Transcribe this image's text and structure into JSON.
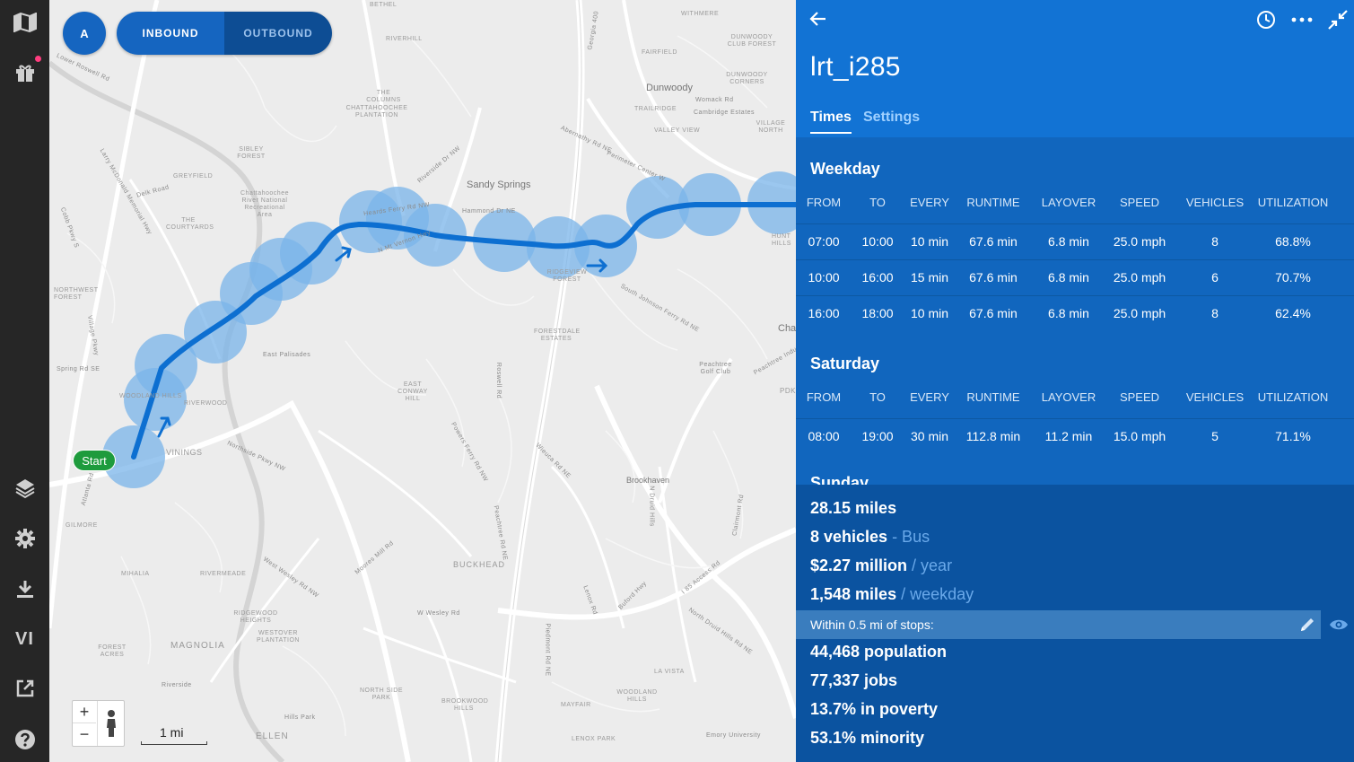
{
  "sidebar": {
    "items": [
      {
        "name": "map",
        "icon": "map-icon"
      },
      {
        "name": "gift",
        "icon": "gift-icon"
      },
      {
        "name": "layers",
        "icon": "layers-icon"
      },
      {
        "name": "settings",
        "icon": "gear-icon"
      },
      {
        "name": "download",
        "icon": "download-icon"
      },
      {
        "name": "vi",
        "label": "VI"
      },
      {
        "name": "export",
        "icon": "export-icon"
      },
      {
        "name": "help",
        "icon": "help-icon"
      }
    ]
  },
  "map": {
    "route_letter": "A",
    "inbound_label": "INBOUND",
    "outbound_label": "OUTBOUND",
    "start_label": "Start",
    "zoom_in": "+",
    "zoom_out": "−",
    "scale": "1 mi",
    "labels": {
      "dunwoody": "Dunwoody",
      "sandy_springs": "Sandy Springs",
      "buckhead": "BUCKHEAD",
      "brookhaven": "Brookhaven",
      "vinings": "VININGS",
      "magnolia": "MAGNOLIA",
      "ellen": "ELLEN",
      "cha": "Cha",
      "pdk": "PDK",
      "riverhill": "RIVERHILL",
      "bethel": "BETHEL",
      "the_columns": "THE COLUMNS",
      "chattahoochee_plantation": "CHATTAHOOCHEE PLANTATION",
      "sibley_forest": "SIBLEY FOREST",
      "greyfield": "GREYFIELD",
      "the_courtyards": "THE COURTYARDS",
      "northwest_forest": "NORTHWEST FOREST",
      "woodland_hills": "WOODLAND HILLS",
      "forestdale_estates": "FORESTDALE ESTATES",
      "east_conway_hill": "EAST CONWAY HILL",
      "riverwood": "RIVERWOOD",
      "gilmore": "GILMORE",
      "mihalia": "MIHALIA",
      "rivermeade": "RIVERMEADE",
      "ridgewood_heights": "RIDGEWOOD HEIGHTS",
      "westover_plantation": "WESTOVER PLANTATION",
      "forest_acres": "FOREST ACRES",
      "north_side_park": "NORTH SIDE PARK",
      "brookwood_hills": "BROOKWOOD HILLS",
      "woodland_hills2": "WOODLAND HILLS",
      "mayfair": "MAYFAIR",
      "lenox_park": "LENOX PARK",
      "la_vista": "LA VISTA",
      "fairfield": "FAIRFIELD",
      "trailridge": "TRAILRIDGE",
      "valley_view": "VALLEY VIEW",
      "dunwoody_corners": "DUNWOODY CORNERS",
      "village_north": "VILLAGE NORTH",
      "withmere": "WITHMERE",
      "dunwoody_club_forest": "DUNWOODY CLUB FOREST",
      "chattahoochee_rec": "Chattahoochee River National Recreational Area",
      "east_palisades": "East Palisades",
      "peachtree_golf": "Peachtree Golf Club",
      "hills_park": "Hills Park",
      "emory_university": "Emory University",
      "hunt_hills": "HUNT HILLS",
      "roswell_rd": "Roswell Rd",
      "northside_pkwy": "Northside Pkwy NW",
      "w_wesley": "W Wesley Rd",
      "west_wesley": "West Wesley Rd NW",
      "moores_mill": "Moores Mill Rd",
      "powers_ferry": "Powers Ferry Rd NW",
      "wieuca": "Wieuca Rd NE",
      "n_druid_hills": "N Druid Hills",
      "peachtree_rd": "Peachtree Rd NE",
      "piedmont_rd": "Piedmont Rd NE",
      "lenox_rd": "Lenox Rd",
      "buford_hwy": "Buford Hwy",
      "i85_access": "I 85 Access Rd",
      "north_druid_hills_rd": "North Druid Hills Rd NE",
      "clairmont": "Clairmont Rd",
      "riverside": "Riverside",
      "heards_ferry": "Heards Ferry Rd NW",
      "hammond": "Hammond Dr NE",
      "mt_vernon": "N Mt Vernon Hwy",
      "ridgeview": "RIDGEVIEW FOREST",
      "south_johnson": "South Johnson Ferry Rd NE",
      "abernathy": "Abernathy Rd NE",
      "perimeter": "Perimeter Center W",
      "peachtree_ind": "Peachtree Industrial Blvd",
      "riverside_dr": "Riverside Dr NW",
      "spring_rd": "Spring Rd SE",
      "cobb_pkwy": "Cobb Pkwy S",
      "atlanta_rd": "Atlanta Rd SE",
      "village_pkwy": "Village Pkwy",
      "delk": "Delk Road",
      "larry_mcdonald": "Larry McDonald Memorial Hwy",
      "lower_roswell": "Lower Roswell Rd",
      "georgia_400": "Georgia 400",
      "womack": "Womack Rd",
      "cambridge": "Cambridge Estates"
    }
  },
  "panel": {
    "route_name": "lrt_i285",
    "tabs": [
      "Times",
      "Settings"
    ],
    "columns": [
      "FROM",
      "TO",
      "EVERY",
      "RUNTIME",
      "LAYOVER",
      "SPEED",
      "VEHICLES",
      "UTILIZATION"
    ],
    "weekday": {
      "title": "Weekday",
      "rows": [
        [
          "07:00",
          "10:00",
          "10 min",
          "67.6 min",
          "6.8 min",
          "25.0 mph",
          "8",
          "68.8%"
        ],
        [
          "10:00",
          "16:00",
          "15 min",
          "67.6 min",
          "6.8 min",
          "25.0 mph",
          "6",
          "70.7%"
        ],
        [
          "16:00",
          "18:00",
          "10 min",
          "67.6 min",
          "6.8 min",
          "25.0 mph",
          "8",
          "62.4%"
        ]
      ]
    },
    "saturday": {
      "title": "Saturday",
      "rows": [
        [
          "08:00",
          "19:00",
          "30 min",
          "112.8 min",
          "11.2 min",
          "15.0 mph",
          "5",
          "71.1%"
        ]
      ]
    },
    "sunday": {
      "title": "Sunday"
    },
    "stats": {
      "miles": "28.15 miles",
      "vehicles": "8 vehicles",
      "vehicles_type": " - Bus",
      "cost": "$2.27 million",
      "cost_unit": " / year",
      "weekday_miles": "1,548 miles",
      "weekday_unit": " / weekday",
      "within_label": "Within 0.5 mi of stops:",
      "population": "44,468 population",
      "jobs": "77,337 jobs",
      "poverty": "13.7% in poverty",
      "minority": "53.1% minority"
    },
    "colors": {
      "header": "#1273d4",
      "schedule_bg": "#1166be",
      "stats_bg": "#0b53a0",
      "route_line": "#0d6fd1",
      "buffer": "#7ab4ea",
      "start_badge": "#1e9b3d"
    }
  }
}
